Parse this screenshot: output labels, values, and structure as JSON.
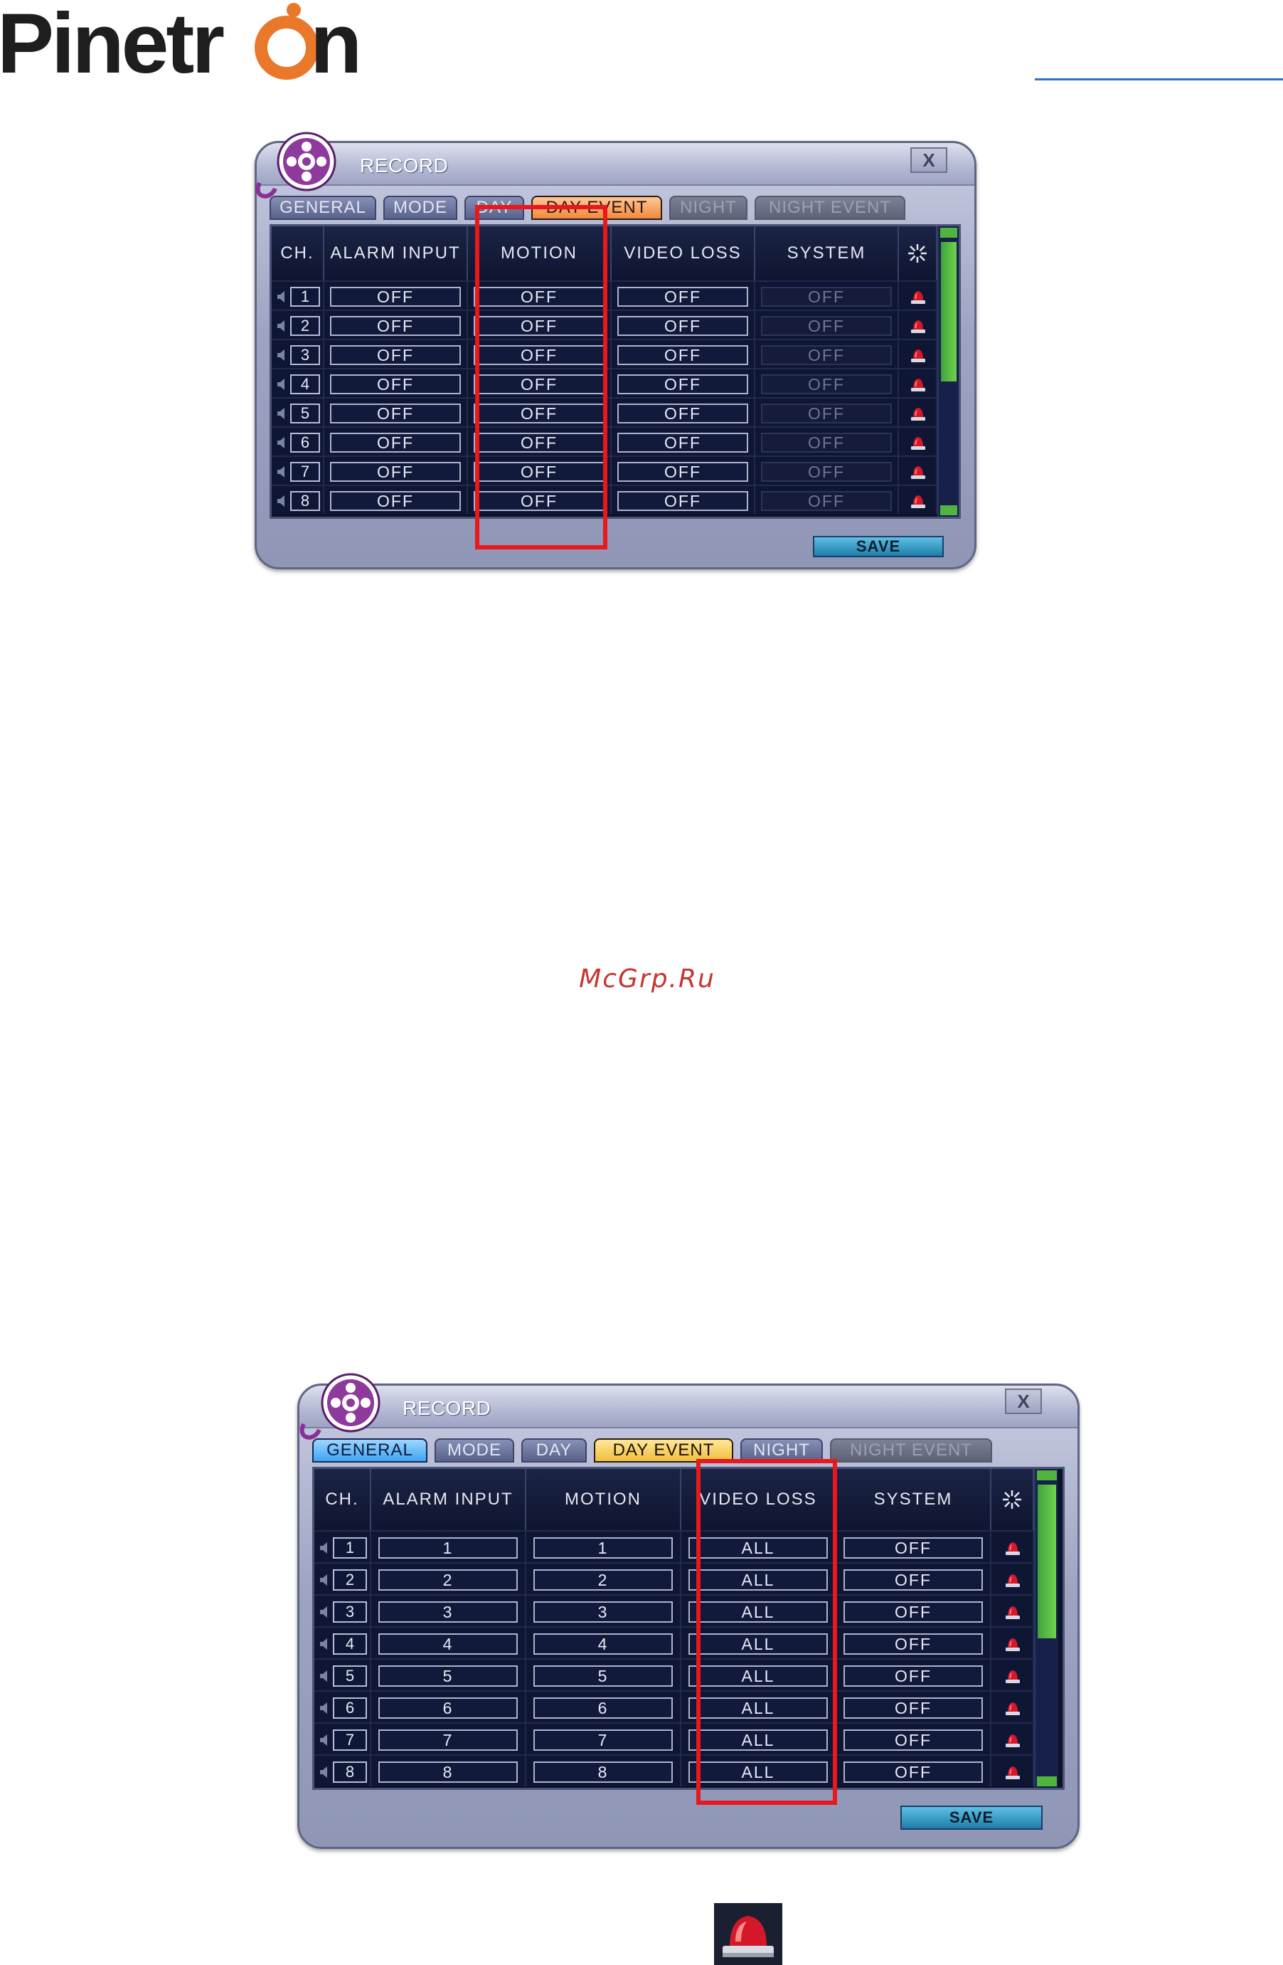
{
  "logo": {
    "text": "Pinetron"
  },
  "watermark": "McGrp.Ru",
  "dialogs": [
    {
      "title": "RECORD",
      "close_label": "X",
      "tabs": [
        {
          "label": "GENERAL",
          "state": "normal"
        },
        {
          "label": "MODE",
          "state": "normal"
        },
        {
          "label": "DAY",
          "state": "normal"
        },
        {
          "label": "DAY EVENT",
          "state": "active"
        },
        {
          "label": "NIGHT",
          "state": "disabled"
        },
        {
          "label": "NIGHT EVENT",
          "state": "disabled"
        }
      ],
      "columns": [
        "CH.",
        "ALARM INPUT",
        "MOTION",
        "VIDEO LOSS",
        "SYSTEM"
      ],
      "rows": [
        {
          "ch": "1",
          "alarm_input": "OFF",
          "motion": "OFF",
          "video_loss": "OFF",
          "system": "OFF"
        },
        {
          "ch": "2",
          "alarm_input": "OFF",
          "motion": "OFF",
          "video_loss": "OFF",
          "system": "OFF"
        },
        {
          "ch": "3",
          "alarm_input": "OFF",
          "motion": "OFF",
          "video_loss": "OFF",
          "system": "OFF"
        },
        {
          "ch": "4",
          "alarm_input": "OFF",
          "motion": "OFF",
          "video_loss": "OFF",
          "system": "OFF"
        },
        {
          "ch": "5",
          "alarm_input": "OFF",
          "motion": "OFF",
          "video_loss": "OFF",
          "system": "OFF"
        },
        {
          "ch": "6",
          "alarm_input": "OFF",
          "motion": "OFF",
          "video_loss": "OFF",
          "system": "OFF"
        },
        {
          "ch": "7",
          "alarm_input": "OFF",
          "motion": "OFF",
          "video_loss": "OFF",
          "system": "OFF"
        },
        {
          "ch": "8",
          "alarm_input": "OFF",
          "motion": "OFF",
          "video_loss": "OFF",
          "system": "OFF"
        }
      ],
      "system_disabled": true,
      "save_label": "SAVE",
      "highlighted_column": "MOTION"
    },
    {
      "title": "RECORD",
      "close_label": "X",
      "tabs": [
        {
          "label": "GENERAL",
          "state": "active-blue"
        },
        {
          "label": "MODE",
          "state": "normal"
        },
        {
          "label": "DAY",
          "state": "normal"
        },
        {
          "label": "DAY EVENT",
          "state": "active-yellow"
        },
        {
          "label": "NIGHT",
          "state": "normal"
        },
        {
          "label": "NIGHT EVENT",
          "state": "disabled"
        }
      ],
      "columns": [
        "CH.",
        "ALARM INPUT",
        "MOTION",
        "VIDEO LOSS",
        "SYSTEM"
      ],
      "rows": [
        {
          "ch": "1",
          "alarm_input": "1",
          "motion": "1",
          "video_loss": "ALL",
          "system": "OFF"
        },
        {
          "ch": "2",
          "alarm_input": "2",
          "motion": "2",
          "video_loss": "ALL",
          "system": "OFF"
        },
        {
          "ch": "3",
          "alarm_input": "3",
          "motion": "3",
          "video_loss": "ALL",
          "system": "OFF"
        },
        {
          "ch": "4",
          "alarm_input": "4",
          "motion": "4",
          "video_loss": "ALL",
          "system": "OFF"
        },
        {
          "ch": "5",
          "alarm_input": "5",
          "motion": "5",
          "video_loss": "ALL",
          "system": "OFF"
        },
        {
          "ch": "6",
          "alarm_input": "6",
          "motion": "6",
          "video_loss": "ALL",
          "system": "OFF"
        },
        {
          "ch": "7",
          "alarm_input": "7",
          "motion": "7",
          "video_loss": "ALL",
          "system": "OFF"
        },
        {
          "ch": "8",
          "alarm_input": "8",
          "motion": "8",
          "video_loss": "ALL",
          "system": "OFF"
        }
      ],
      "system_disabled": false,
      "save_label": "SAVE",
      "highlighted_column": "VIDEO LOSS"
    }
  ],
  "icons": {
    "reel": "film-reel-icon",
    "speaker": "speaker-icon",
    "alarm": "alarm-siren-icon",
    "settings": "settings-asterisk-icon"
  },
  "colors": {
    "highlight": "#e8181c",
    "logo_dark": "#1e1e1e",
    "logo_orange": "#e9782a",
    "accent_blue": "#2f74c0"
  }
}
